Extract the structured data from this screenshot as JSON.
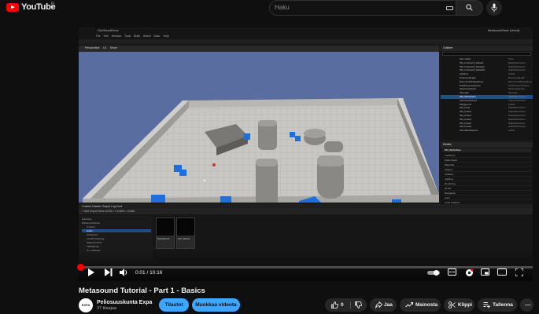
{
  "header": {
    "logo_text": "YouTube",
    "logo_sup": "FI",
    "search_placeholder": "Haku",
    "icons": [
      "menu-icon",
      "youtube-logo-icon",
      "keyboard-icon",
      "search-icon",
      "mic-icon"
    ]
  },
  "video": {
    "editor": {
      "window_title": "ClubSoundDemo",
      "window_title_right": "MetasoundGame (Unreal)",
      "menus": "File   Edit   Window   Tools   Build   Select   Actor   Help",
      "viewport_bar": "Perspective   Lit   Show",
      "outliner_title": "Outliner",
      "outliner_rows": [
        {
          "name": "Item Label",
          "type": "Type",
          "sel": false
        },
        {
          "name": "SM_CubeGrid_Default",
          "type": "StaticMeshActor",
          "sel": false
        },
        {
          "name": "SM_CubeGrid_Default2",
          "type": "StaticMeshActor",
          "sel": false
        },
        {
          "name": "SM_CubeGrid_Default3",
          "type": "StaticMeshActor",
          "sel": false
        },
        {
          "name": "Lighting",
          "type": "Folder",
          "sel": false
        },
        {
          "name": "DirectionalLight",
          "type": "DirectionalLight",
          "sel": false
        },
        {
          "name": "ExponentialHeightFog",
          "type": "ExponentialHeightFog",
          "sel": false
        },
        {
          "name": "PostProcessVolume",
          "type": "PostProcessVolume",
          "sel": false
        },
        {
          "name": "SkyAtmosphere",
          "type": "SkyAtmosphere",
          "sel": false
        },
        {
          "name": "SkyLight",
          "type": "SkyLight",
          "sel": false
        },
        {
          "name": "SM_SkySphere",
          "type": "StaticMeshActor",
          "sel": true
        },
        {
          "name": "VolumetricCloud",
          "type": "VolumetricCloud",
          "sel": false
        },
        {
          "name": "Playground",
          "type": "Folder",
          "sel": false
        },
        {
          "name": "SM_Cube",
          "type": "StaticMeshActor",
          "sel": false
        },
        {
          "name": "SM_Cube2",
          "type": "StaticMeshActor",
          "sel": false
        },
        {
          "name": "SM_Cube3",
          "type": "StaticMeshActor",
          "sel": false
        },
        {
          "name": "SM_Cube4",
          "type": "StaticMeshActor",
          "sel": false
        },
        {
          "name": "SM_Cube5",
          "type": "StaticMeshActor",
          "sel": false
        },
        {
          "name": "SM_Cube6",
          "type": "StaticMeshActor",
          "sel": false
        },
        {
          "name": "SimulatedObjects",
          "type": "Folder",
          "sel": false
        }
      ],
      "outliner_status": "Outliner filtered",
      "details_title": "Details",
      "details_selected": "SM_SkySphere",
      "details_rows": [
        "Transform",
        "Static Mesh",
        "Materials",
        "Physics",
        "Collision",
        "Lighting",
        "Rendering",
        "HLOD",
        "Navigation",
        "Actor",
        "Level Instance",
        "Cooking",
        "World Partition"
      ],
      "cb_tabs": "Content Drawer   Output Log   Cmd",
      "cb_bar": "+ Add   Import   Save All   All > Content > Audio",
      "cb_tree": [
        {
          "name": "Favorites",
          "sel": false
        },
        {
          "name": "MetasoundGame",
          "sel": false
        },
        {
          "name": "Content",
          "sel": false
        },
        {
          "name": "Audio",
          "sel": true
        },
        {
          "name": "Characters",
          "sel": false
        },
        {
          "name": "LevelPrototyping",
          "sel": false
        },
        {
          "name": "StarterContent",
          "sel": false
        },
        {
          "name": "ThirdPerson",
          "sel": false
        },
        {
          "name": "C++ Classes",
          "sel": false
        }
      ],
      "cb_tiles": [
        "MetaSound",
        "SW_Waves"
      ]
    }
  },
  "player": {
    "progress": 0.0016,
    "time": "0:01 / 10:16"
  },
  "title": "Metasound Tutorial - Part 1 - Basics",
  "channel": {
    "name": "Peliosuuskunta Expa",
    "subscribers": "37 tilaajaa",
    "avatar_text": "EXPA"
  },
  "buttons": {
    "stats": "Tilastot",
    "edit": "Muokkaa videota",
    "likes": "0",
    "share": "Jaa",
    "promote": "Mainosta",
    "clip": "Klippi",
    "save": "Tallenna"
  }
}
